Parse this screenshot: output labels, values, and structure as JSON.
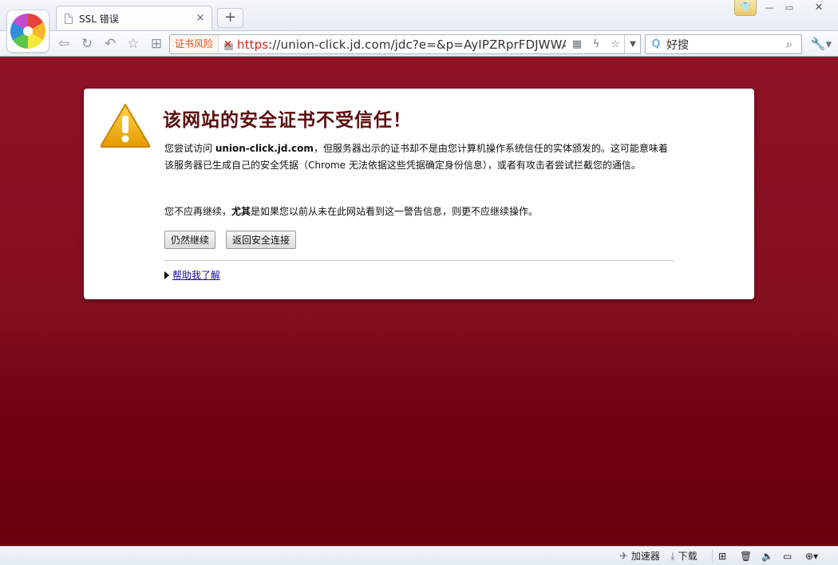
{
  "window": {
    "skin_icon": "shirt-icon",
    "minimize_glyph": "—",
    "maximize_glyph": "▭",
    "close_glyph": "✕"
  },
  "tab": {
    "title": "SSL 错误",
    "close_glyph": "×",
    "new_tab_glyph": "+"
  },
  "toolbar": {
    "back_glyph": "⇦",
    "refresh_glyph": "↻",
    "undo_glyph": "↶",
    "favorite_glyph": "☆",
    "apps_glyph": "⊞",
    "risk_badge": "证书风险",
    "url_scheme": "https",
    "url_rest": "://union-click.jd.com/jdc?e=&p=AyIPZRprFDJWWA",
    "qrcode_glyph": "▦",
    "flash_glyph": "ϟ",
    "star_glyph": "☆",
    "dropdown_glyph": "▼",
    "search_engine_glyph": "Q",
    "search_value": "好搜",
    "search_glyph": "⌕",
    "tools_glyph": "🔧▾"
  },
  "error": {
    "title": "该网站的安全证书不受信任！",
    "p1_prefix": "您尝试访问 ",
    "p1_host": "union-click.jd.com",
    "p1_suffix": "，但服务器出示的证书却不是由您计算机操作系统信任的实体颁发的。这可能意味着该服务器已生成自己的安全凭据（Chrome 无法依据这些凭据确定身份信息），或者有攻击者尝试拦截您的通信。",
    "p2_prefix": "您不应再继续，",
    "p2_emph": "尤其",
    "p2_suffix": "是如果您以前从未在此网站看到这一警告信息，则更不应继续操作。",
    "proceed_button": "仍然继续",
    "back_button": "返回安全连接",
    "help_link": "帮助我了解"
  },
  "statusbar": {
    "accelerator_label": "加速器",
    "download_label": "下载",
    "accelerator_glyph": "✈",
    "download_glyph": "⤓",
    "add_glyph": "⊞",
    "trash_glyph": "🗑",
    "volume_glyph": "🔈",
    "window_glyph": "▭",
    "zoom_glyph": "⊕▾"
  },
  "colors": {
    "page_bg_top": "#8e1124",
    "page_bg_bottom": "#6a000d",
    "title_color": "#5c0c0c",
    "url_scheme_color": "#d52b1e",
    "risk_badge_color": "#d9531e",
    "link_color": "#1a0dab"
  }
}
